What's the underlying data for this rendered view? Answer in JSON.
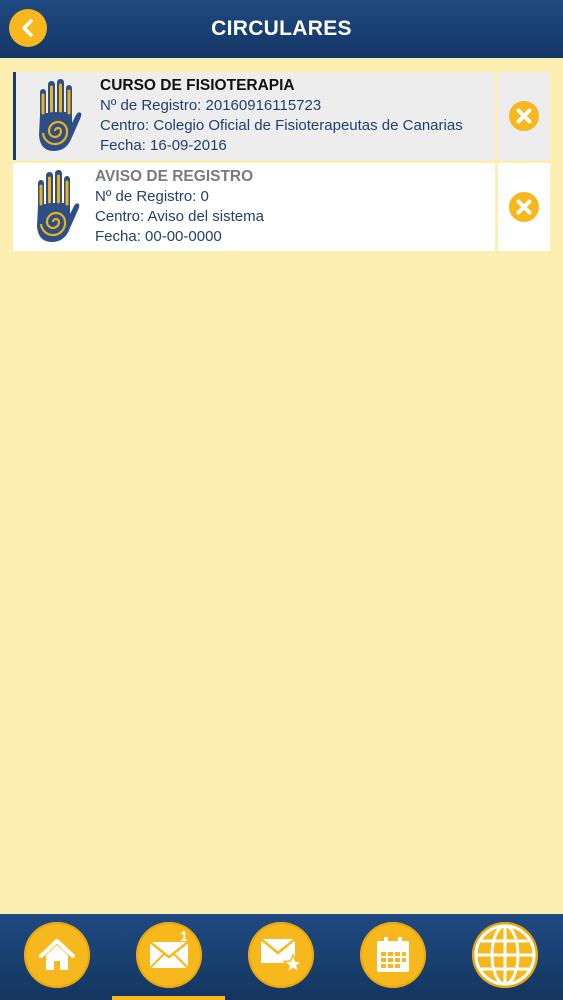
{
  "header": {
    "title": "CIRCULARES",
    "back_icon": "chevron-left-icon"
  },
  "circulars": [
    {
      "title": "CURSO DE FISIOTERAPIA",
      "registro": "Nº de Registro: 20160916115723",
      "centro": "Centro: Colegio Oficial de Fisioterapeutas de Canarias",
      "fecha": "Fecha: 16-09-2016",
      "state": "read"
    },
    {
      "title": "AVISO DE REGISTRO",
      "registro": "Nº de Registro: 0",
      "centro": "Centro: Aviso del sistema",
      "fecha": "Fecha: 00-00-0000",
      "state": "unread"
    }
  ],
  "bottom_nav": {
    "items": [
      "home-icon",
      "mail-icon",
      "mail-star-icon",
      "calendar-icon",
      "globe-icon"
    ],
    "mail_badge": "1",
    "active_index": 1
  },
  "colors": {
    "header": "#1f4a82",
    "accent": "#f6b81c",
    "background": "#fdefb2"
  }
}
